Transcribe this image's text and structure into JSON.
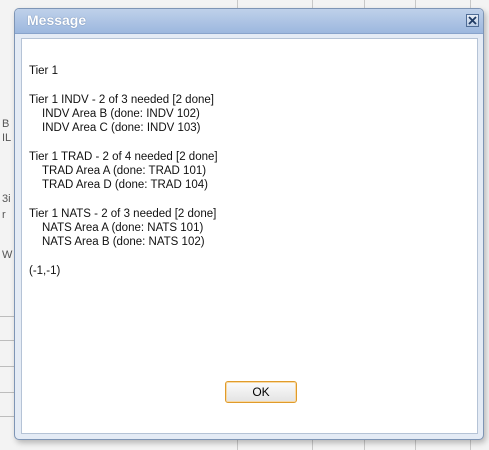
{
  "dialog": {
    "title": "Message",
    "close_icon": "close-icon",
    "ok_label": "OK",
    "lines": {
      "l0": "Tier 1",
      "l1": "Tier 1 INDV - 2 of 3 needed [2 done]",
      "l2": "INDV Area B (done: INDV 102)",
      "l3": "INDV Area C (done: INDV 103)",
      "l4": "Tier 1 TRAD - 2 of 4 needed [2 done]",
      "l5": "TRAD Area A (done: TRAD 101)",
      "l6": "TRAD Area D (done: TRAD 104)",
      "l7": "Tier 1 NATS - 2 of 3 needed [2 done]",
      "l8": "NATS Area A (done: NATS 101)",
      "l9": "NATS Area B (done: NATS 102)",
      "l10": "(-1,-1)"
    }
  },
  "background": {
    "fragments": [
      "B",
      "IL",
      "3i",
      "r",
      "W"
    ]
  },
  "colors": {
    "titlebar": "#9cb7de",
    "ok_border": "#e09b2a"
  }
}
